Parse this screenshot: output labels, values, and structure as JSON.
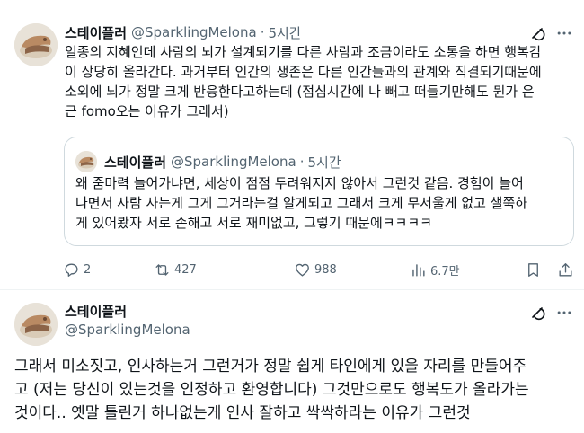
{
  "post1": {
    "author_name": "스테이플러",
    "handle": "@SparklingMelona",
    "separator": "·",
    "time": "5시간",
    "text_lines": [
      "일종의 지혜인데 사람의 뇌가 설계되기를 다른 사람과 조금이라도 소통을 하면 행복감",
      "이 상당히 올라간다. 과거부터 인간의 생존은 다른 인간들과의 관계와 직결되기때문에",
      "소외에 뇌가 정말 크게 반응한다고하는데 (점심시간에 나 빼고 떠들기만해도 뭔가 은",
      "근 fomo오는 이유가 그래서)"
    ],
    "quote": {
      "author_name": "스테이플러",
      "handle": "@SparklingMelona",
      "separator": "·",
      "time": "5시간",
      "text_lines": [
        "왜 줌마력 늘어가냐면, 세상이 점점 두려워지지 않아서 그런것 같음. 경험이 늘어",
        "나면서 사람 사는게 그게 그거라는걸 알게되고 그래서 크게 무서울게 없고 샐쭉하",
        "게 있어봤자 서로 손해고 서로 재미없고, 그렇기 때문에ㅋㅋㅋㅋ"
      ]
    },
    "actions": {
      "replies": "2",
      "reposts": "427",
      "likes": "988",
      "views": "6.7만"
    }
  },
  "post2": {
    "author_name": "스테이플러",
    "handle": "@SparklingMelona",
    "text_lines": [
      "그래서 미소짓고, 인사하는거 그런거가 정말 쉽게 타인에게 있을 자리를 만들어주",
      "고 (저는 당신이 있는것을 인정하고 환영합니다) 그것만으로도 행복도가 올라가는",
      "것이다.. 옛말 틀린거 하나없는게 인사 잘하고 싹싹하라는 이유가 그런것"
    ]
  },
  "icons": {
    "grok": "grok-icon",
    "more": "more-icon",
    "reply": "reply-icon",
    "repost": "repost-icon",
    "like": "like-icon",
    "views": "views-icon",
    "bookmark": "bookmark-icon",
    "share": "share-icon"
  },
  "colors": {
    "text_primary": "#0f1419",
    "text_secondary": "#536471",
    "border": "#cfd9de",
    "divider": "#eff3f4"
  }
}
